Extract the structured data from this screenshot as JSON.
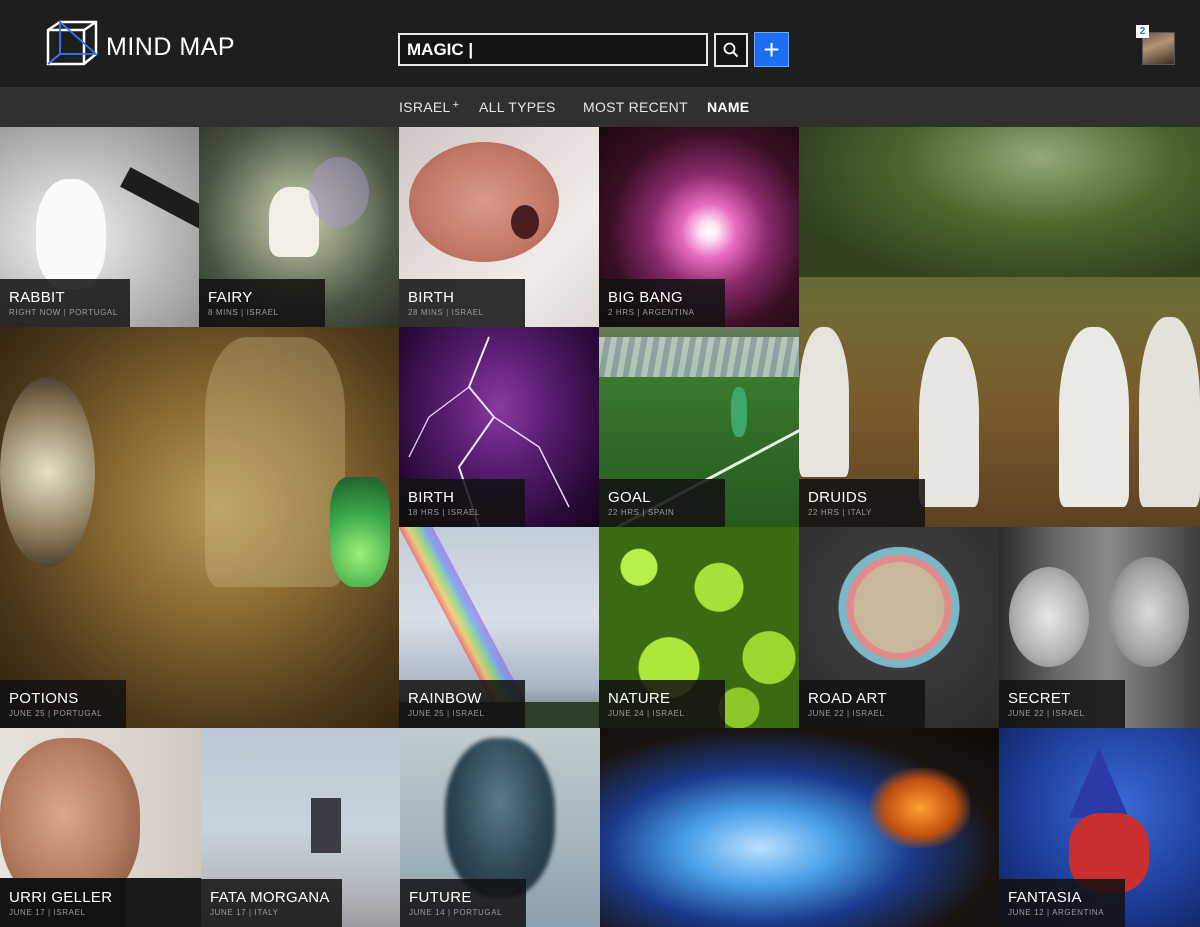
{
  "brand": {
    "name": "MIND MAP"
  },
  "search": {
    "value": "MAGIC |"
  },
  "add_button": {
    "label": "+"
  },
  "notifications": {
    "count": "2"
  },
  "filters": [
    {
      "label": "ISRAEL",
      "suffix": "+"
    },
    {
      "label": "ALL TYPES"
    },
    {
      "label": "MOST RECENT"
    },
    {
      "label": "NAME"
    }
  ],
  "tiles": [
    {
      "title": "RABBIT",
      "meta": "RIGHT NOW | PORTUGAL"
    },
    {
      "title": "FAIRY",
      "meta": "8 MINS | ISRAEL"
    },
    {
      "title": "BIRTH",
      "meta": "28 MINS | ISRAEL"
    },
    {
      "title": "BIG BANG",
      "meta": "2 HRS | ARGENTINA"
    },
    {
      "title": "DRUIDS",
      "meta": "22 HRS | ITALY"
    },
    {
      "title": "POTIONS",
      "meta": "JUNE 25 | PORTUGAL"
    },
    {
      "title": "BIRTH",
      "meta": "18 HRS | ISRAEL"
    },
    {
      "title": "GOAL",
      "meta": "22 HRS | SPAIN"
    },
    {
      "title": "RAINBOW",
      "meta": "JUNE 25 | ISRAEL"
    },
    {
      "title": "NATURE",
      "meta": "JUNE 24 | ISRAEL"
    },
    {
      "title": "ROAD ART",
      "meta": "JUNE 22 | ISRAEL"
    },
    {
      "title": "SECRET",
      "meta": "JUNE 22 | ISRAEL"
    },
    {
      "title": "URRI GELLER",
      "meta": "JUNE 17 | ISRAEL"
    },
    {
      "title": "FATA MORGANA",
      "meta": "JUNE 17 | ITALY"
    },
    {
      "title": "FUTURE",
      "meta": "JUNE 14 | PORTUGAL"
    },
    {
      "title": "",
      "meta": ""
    },
    {
      "title": "FANTASIA",
      "meta": "JUNE 12 | ARGENTINA"
    }
  ],
  "colors": {
    "accent": "#1c6ff0",
    "header_bg": "#1e1e1e",
    "filterbar_bg": "#303030"
  }
}
